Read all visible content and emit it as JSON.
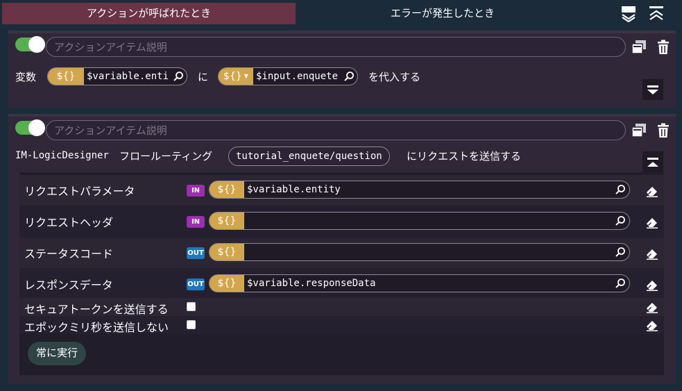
{
  "tabs": [
    {
      "label": "アクションが呼ばれたとき",
      "active": true
    },
    {
      "label": "エラーが発生したとき",
      "active": false
    }
  ],
  "action1": {
    "description_placeholder": "アクションアイテム説明",
    "var_label": "変数",
    "badge": "${}",
    "target_value": "$variable.enti",
    "connector": "に",
    "source_badge": "${}",
    "source_value": "$input.enquete",
    "suffix": "を代入する"
  },
  "action2": {
    "description_placeholder": "アクションアイテム説明",
    "service": "IM-LogicDesigner",
    "type_label": "フロールーティング",
    "route": "tutorial_enquete/question",
    "suffix": "にリクエストを送信する",
    "params": [
      {
        "label": "リクエストパラメータ",
        "direction": "IN",
        "badge": "${}",
        "value": "$variable.entity"
      },
      {
        "label": "リクエストヘッダ",
        "direction": "IN",
        "badge": "${}",
        "value": ""
      },
      {
        "label": "ステータスコード",
        "direction": "OUT",
        "badge": "${}",
        "value": ""
      },
      {
        "label": "レスポンスデータ",
        "direction": "OUT",
        "badge": "${}",
        "value": "$variable.responseData"
      }
    ],
    "checks": [
      {
        "label": "セキュアトークンを送信する",
        "checked": false
      },
      {
        "label": "エポックミリ秒を送信しない",
        "checked": false
      }
    ],
    "always_button": "常に実行"
  },
  "colors": {
    "accent_tab": "#6b3346",
    "toggle_on": "#56b050",
    "var_badge": "#d2a64d",
    "in_badge": "#9a2fb0",
    "out_badge": "#1e78c0"
  }
}
